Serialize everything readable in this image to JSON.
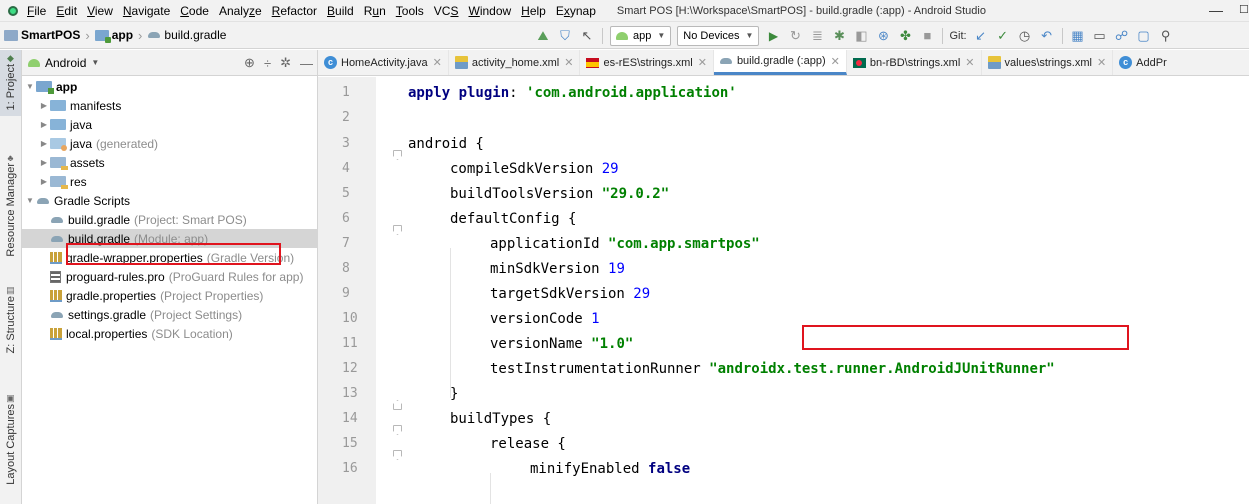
{
  "menubar": {
    "items": [
      {
        "prefix": "",
        "mnemonic": "F",
        "rest": "ile"
      },
      {
        "prefix": "",
        "mnemonic": "E",
        "rest": "dit"
      },
      {
        "prefix": "",
        "mnemonic": "V",
        "rest": "iew"
      },
      {
        "prefix": "",
        "mnemonic": "N",
        "rest": "avigate"
      },
      {
        "prefix": "",
        "mnemonic": "C",
        "rest": "ode"
      },
      {
        "prefix": "Analy",
        "mnemonic": "z",
        "rest": "e"
      },
      {
        "prefix": "",
        "mnemonic": "R",
        "rest": "efactor"
      },
      {
        "prefix": "",
        "mnemonic": "B",
        "rest": "uild"
      },
      {
        "prefix": "R",
        "mnemonic": "u",
        "rest": "n"
      },
      {
        "prefix": "",
        "mnemonic": "T",
        "rest": "ools"
      },
      {
        "prefix": "VC",
        "mnemonic": "S",
        "rest": ""
      },
      {
        "prefix": "",
        "mnemonic": "W",
        "rest": "indow"
      },
      {
        "prefix": "",
        "mnemonic": "H",
        "rest": "elp"
      },
      {
        "prefix": "E",
        "mnemonic": "x",
        "rest": "ynap"
      }
    ],
    "window_title": "Smart POS [H:\\Workspace\\SmartPOS] - build.gradle (:app) - Android Studio",
    "minimize": "—",
    "maximize": "☐"
  },
  "navbar": {
    "breadcrumb": [
      "SmartPOS",
      "app",
      "build.gradle"
    ],
    "config_combo": "app",
    "device_combo": "No Devices",
    "git_label": "Git:"
  },
  "stripe": {
    "project": "1: Project",
    "resource_manager": "Resource Manager",
    "structure": "Z: Structure",
    "layout_captures": "Layout Captures"
  },
  "project_panel": {
    "view_mode": "Android",
    "tree": [
      {
        "label": "app",
        "hint": "",
        "bold": true
      },
      {
        "label": "manifests",
        "hint": ""
      },
      {
        "label": "java",
        "hint": ""
      },
      {
        "label": "java",
        "hint": "(generated)"
      },
      {
        "label": "assets",
        "hint": ""
      },
      {
        "label": "res",
        "hint": ""
      },
      {
        "label": "Gradle Scripts",
        "hint": ""
      },
      {
        "label": "build.gradle",
        "hint": "(Project: Smart POS)"
      },
      {
        "label": "build.gradle",
        "hint": "(Module: app)"
      },
      {
        "label": "gradle-wrapper.properties",
        "hint": "(Gradle Version)"
      },
      {
        "label": "proguard-rules.pro",
        "hint": "(ProGuard Rules for app)"
      },
      {
        "label": "gradle.properties",
        "hint": "(Project Properties)"
      },
      {
        "label": "settings.gradle",
        "hint": "(Project Settings)"
      },
      {
        "label": "local.properties",
        "hint": "(SDK Location)"
      }
    ]
  },
  "editor_tabs": [
    {
      "label": "HomeActivity.java"
    },
    {
      "label": "activity_home.xml"
    },
    {
      "label": "es-rES\\strings.xml"
    },
    {
      "label": "build.gradle (:app)"
    },
    {
      "label": "bn-rBD\\strings.xml"
    },
    {
      "label": "values\\strings.xml"
    },
    {
      "label": "AddPr"
    }
  ],
  "code": {
    "line_numbers": [
      "1",
      "2",
      "3",
      "4",
      "5",
      "6",
      "7",
      "8",
      "9",
      "10",
      "11",
      "12",
      "13",
      "14",
      "15",
      "16"
    ],
    "l1": {
      "kw": "apply plugin",
      "p": ": ",
      "str": "'com.android.application'"
    },
    "l3": {
      "a": "android {"
    },
    "l4": {
      "a": "compileSdkVersion ",
      "n": "29"
    },
    "l5": {
      "a": "buildToolsVersion ",
      "s": "\"29.0.2\""
    },
    "l6": {
      "a": "defaultConfig {"
    },
    "l7": {
      "a": "applicationId ",
      "s": "\"com.app.smartpos\""
    },
    "l8": {
      "a": "minSdkVersion ",
      "n": "19"
    },
    "l9": {
      "a": "targetSdkVersion ",
      "n": "29"
    },
    "l10": {
      "a": "versionCode ",
      "n": "1"
    },
    "l11": {
      "a": "versionName ",
      "s": "\"1.0\""
    },
    "l12": {
      "a": "testInstrumentationRunner ",
      "s": "\"androidx.test.runner.AndroidJUnitRunner\""
    },
    "l13": {
      "a": "}"
    },
    "l14": {
      "a": "buildTypes {"
    },
    "l15": {
      "a": "release {"
    },
    "l16": {
      "a": "minifyEnabled ",
      "k": "false"
    }
  },
  "colors": {
    "highlight_box": "#e0141e",
    "active_tab_underline": "#4a86c7",
    "keyword": "#000080",
    "string": "#008000",
    "number": "#0000ff"
  }
}
